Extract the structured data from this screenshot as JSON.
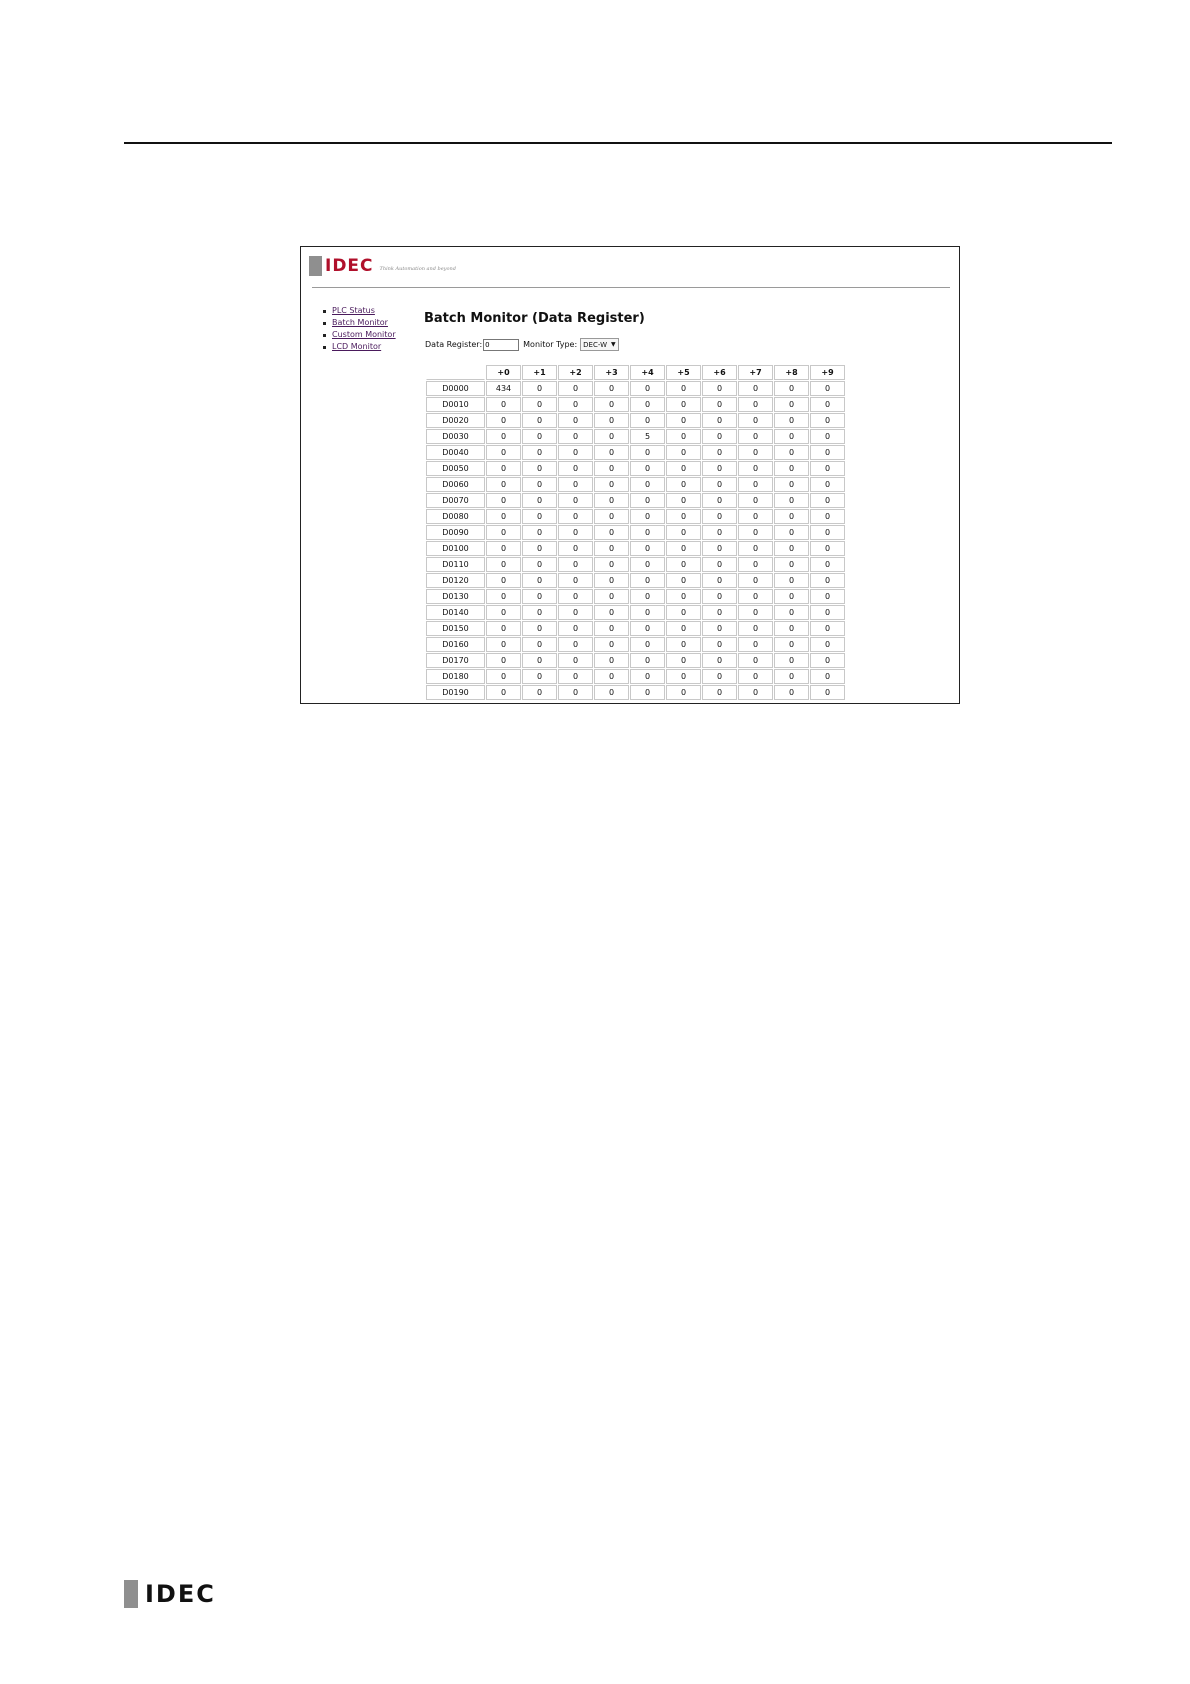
{
  "brand": {
    "name": "IDEC",
    "tagline": "Think Automation and beyond"
  },
  "nav": {
    "items": [
      {
        "label": "PLC Status"
      },
      {
        "label": "Batch Monitor"
      },
      {
        "label": "Custom Monitor"
      },
      {
        "label": "LCD Monitor"
      }
    ]
  },
  "main": {
    "title": "Batch Monitor (Data Register)",
    "data_register_label": "Data Register:",
    "data_register_value": "0",
    "monitor_type_label": "Monitor Type:",
    "monitor_type_value": "DEC-W"
  },
  "table": {
    "columns": [
      "+0",
      "+1",
      "+2",
      "+3",
      "+4",
      "+5",
      "+6",
      "+7",
      "+8",
      "+9"
    ],
    "rows": [
      {
        "label": "D0000",
        "values": [
          "434",
          "0",
          "0",
          "0",
          "0",
          "0",
          "0",
          "0",
          "0",
          "0"
        ]
      },
      {
        "label": "D0010",
        "values": [
          "0",
          "0",
          "0",
          "0",
          "0",
          "0",
          "0",
          "0",
          "0",
          "0"
        ]
      },
      {
        "label": "D0020",
        "values": [
          "0",
          "0",
          "0",
          "0",
          "0",
          "0",
          "0",
          "0",
          "0",
          "0"
        ]
      },
      {
        "label": "D0030",
        "values": [
          "0",
          "0",
          "0",
          "0",
          "5",
          "0",
          "0",
          "0",
          "0",
          "0"
        ]
      },
      {
        "label": "D0040",
        "values": [
          "0",
          "0",
          "0",
          "0",
          "0",
          "0",
          "0",
          "0",
          "0",
          "0"
        ]
      },
      {
        "label": "D0050",
        "values": [
          "0",
          "0",
          "0",
          "0",
          "0",
          "0",
          "0",
          "0",
          "0",
          "0"
        ]
      },
      {
        "label": "D0060",
        "values": [
          "0",
          "0",
          "0",
          "0",
          "0",
          "0",
          "0",
          "0",
          "0",
          "0"
        ]
      },
      {
        "label": "D0070",
        "values": [
          "0",
          "0",
          "0",
          "0",
          "0",
          "0",
          "0",
          "0",
          "0",
          "0"
        ]
      },
      {
        "label": "D0080",
        "values": [
          "0",
          "0",
          "0",
          "0",
          "0",
          "0",
          "0",
          "0",
          "0",
          "0"
        ]
      },
      {
        "label": "D0090",
        "values": [
          "0",
          "0",
          "0",
          "0",
          "0",
          "0",
          "0",
          "0",
          "0",
          "0"
        ]
      },
      {
        "label": "D0100",
        "values": [
          "0",
          "0",
          "0",
          "0",
          "0",
          "0",
          "0",
          "0",
          "0",
          "0"
        ]
      },
      {
        "label": "D0110",
        "values": [
          "0",
          "0",
          "0",
          "0",
          "0",
          "0",
          "0",
          "0",
          "0",
          "0"
        ]
      },
      {
        "label": "D0120",
        "values": [
          "0",
          "0",
          "0",
          "0",
          "0",
          "0",
          "0",
          "0",
          "0",
          "0"
        ]
      },
      {
        "label": "D0130",
        "values": [
          "0",
          "0",
          "0",
          "0",
          "0",
          "0",
          "0",
          "0",
          "0",
          "0"
        ]
      },
      {
        "label": "D0140",
        "values": [
          "0",
          "0",
          "0",
          "0",
          "0",
          "0",
          "0",
          "0",
          "0",
          "0"
        ]
      },
      {
        "label": "D0150",
        "values": [
          "0",
          "0",
          "0",
          "0",
          "0",
          "0",
          "0",
          "0",
          "0",
          "0"
        ]
      },
      {
        "label": "D0160",
        "values": [
          "0",
          "0",
          "0",
          "0",
          "0",
          "0",
          "0",
          "0",
          "0",
          "0"
        ]
      },
      {
        "label": "D0170",
        "values": [
          "0",
          "0",
          "0",
          "0",
          "0",
          "0",
          "0",
          "0",
          "0",
          "0"
        ]
      },
      {
        "label": "D0180",
        "values": [
          "0",
          "0",
          "0",
          "0",
          "0",
          "0",
          "0",
          "0",
          "0",
          "0"
        ]
      },
      {
        "label": "D0190",
        "values": [
          "0",
          "0",
          "0",
          "0",
          "0",
          "0",
          "0",
          "0",
          "0",
          "0"
        ]
      }
    ]
  },
  "footer": {
    "brand": "IDEC"
  },
  "colors": {
    "brand_red": "#b0102b",
    "link": "#4a1a5c",
    "logo_gray": "#8f8f8f"
  }
}
